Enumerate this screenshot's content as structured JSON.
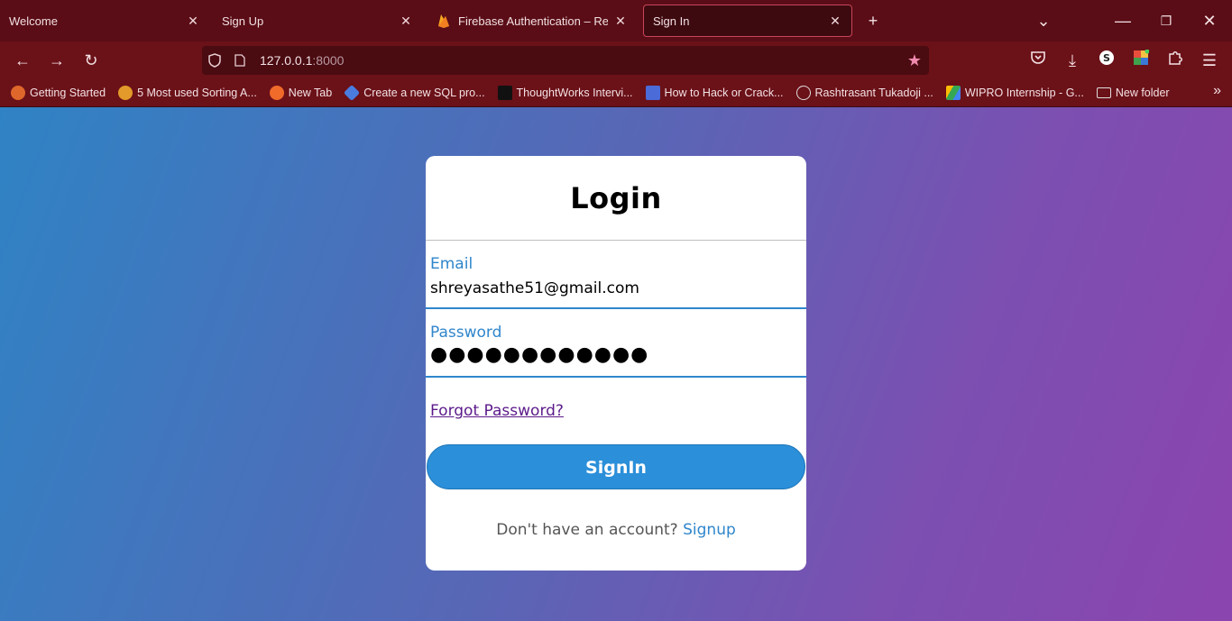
{
  "tabs": [
    {
      "title": "Welcome",
      "active": false
    },
    {
      "title": "Sign Up",
      "active": false
    },
    {
      "title": "Firebase Authentication – Realtim",
      "active": false,
      "icon": "firebase-icon"
    },
    {
      "title": "Sign In",
      "active": true
    }
  ],
  "nav": {
    "url_host": "127.0.0.1",
    "url_port": ":8000"
  },
  "bookmarks": [
    {
      "label": "Getting Started",
      "icon": "firefox-icon",
      "color": "#e0672b"
    },
    {
      "label": "5 Most used Sorting A...",
      "icon": "crown-icon",
      "color": "#e39a2a"
    },
    {
      "label": "New Tab",
      "icon": "firefox-icon",
      "color": "#f06a2a"
    },
    {
      "label": "Create a new SQL pro...",
      "icon": "diamond-icon",
      "color": "#4a7ce0"
    },
    {
      "label": "ThoughtWorks Intervi...",
      "icon": "medium-icon",
      "color": "#111111"
    },
    {
      "label": "How to Hack or Crack...",
      "icon": "wrench-icon",
      "color": "#4a6bd8"
    },
    {
      "label": "Rashtrasant Tukadoji ...",
      "icon": "globe-icon",
      "color": "#dddddd"
    },
    {
      "label": "WIPRO Internship - G...",
      "icon": "drive-icon",
      "color": "#34a853"
    },
    {
      "label": "New folder",
      "icon": "folder-icon",
      "color": "#dddddd"
    }
  ],
  "login": {
    "title": "Login",
    "email_label": "Email",
    "email_value": "shreyasathe51@gmail.com",
    "password_label": "Password",
    "password_value": "●●●●●●●●●●●●",
    "forgot": "Forgot Password?",
    "signin_button": "SignIn",
    "no_account": "Don't have an account?",
    "signup_link": "Signup"
  },
  "colors": {
    "accent": "#2f86cc",
    "button": "#2b8fd9",
    "chrome": "#6b1118"
  }
}
